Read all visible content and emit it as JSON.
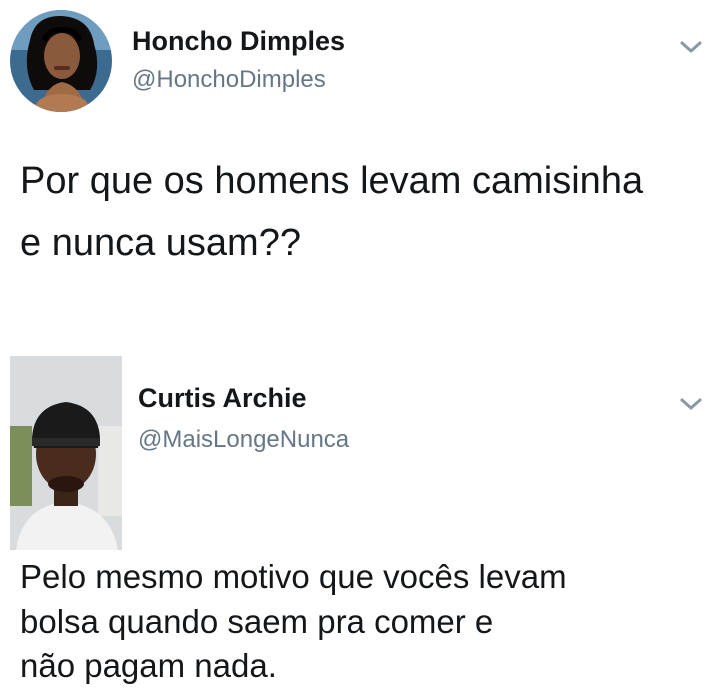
{
  "tweets": [
    {
      "display_name": "Honcho Dimples",
      "handle": "@HonchoDimples",
      "text_lines": [
        "Por que os homens levam camisinha",
        "e nunca usam??"
      ],
      "menu_icon": "chevron-down-icon"
    },
    {
      "display_name": "Curtis Archie",
      "handle": "@MaisLongeNunca",
      "text_lines": [
        "Pelo mesmo motivo que vocês levam",
        "bolsa quando saem pra comer e",
        "não pagam nada."
      ],
      "menu_icon": "chevron-down-icon"
    }
  ],
  "colors": {
    "background": "#ffffff",
    "name_text": "#14171a",
    "handle_text": "#657786",
    "chevron": "#8899a6"
  }
}
